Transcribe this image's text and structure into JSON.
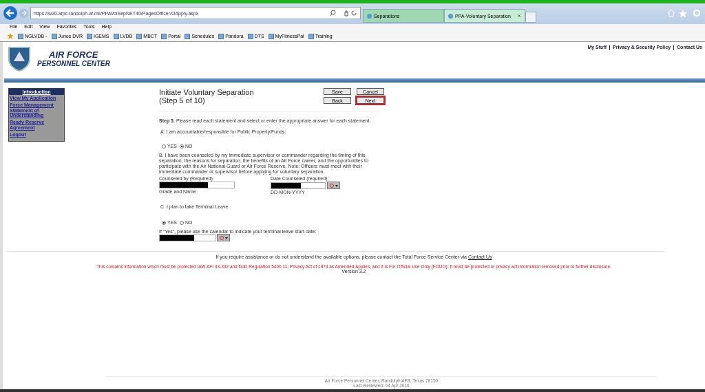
{
  "browser": {
    "url": "https://w20.afpc.randolph.af.mil/PPAVolSepNET40/PagesOfficer/OApply.aspx",
    "tabs": [
      {
        "label": "Separations",
        "selected": false
      },
      {
        "label": "PPA-Voluntary Separation",
        "selected": true
      }
    ],
    "menu": [
      "File",
      "Edit",
      "View",
      "Favorites",
      "Tools",
      "Help"
    ],
    "favorites": [
      "NGLVDB -",
      "Junos DVR",
      "IGEMS",
      "LVDB",
      "MBCT",
      "Portal",
      "Schedules",
      "Pandora",
      "DTS",
      "MyFitnessPal",
      "Training"
    ]
  },
  "top_links": [
    "My Stuff",
    "Privacy & Security Policy",
    "Contact Us"
  ],
  "logo": {
    "line1": "AIR FORCE",
    "line2": "PERSONNEL CENTER"
  },
  "sidebar": {
    "title": "Introduction",
    "items": [
      "View My Application",
      "Force Management Statement of Understanding",
      "Ready Reserve Agreement",
      "Logout"
    ]
  },
  "page": {
    "title": "Initiate Voluntary Separation",
    "subtitle": "(Step 5 of 10)",
    "buttons": [
      {
        "label": "Save",
        "highlighted": false
      },
      {
        "label": "Cancel",
        "highlighted": false
      },
      {
        "label": "Back",
        "highlighted": false
      },
      {
        "label": "Next",
        "highlighted": true
      }
    ],
    "instructions": "**Step 5.** Please read each statement and select or enter the appropriate answer for each statement.",
    "question_a": {
      "text": "A. I am accountable/responsible for Public Property/Funds:",
      "options": [
        {
          "label": "YES",
          "selected": false
        },
        {
          "label": "NO",
          "selected": true
        }
      ]
    },
    "question_b": {
      "text": "B. I have been counseled by my immediate supervisor or commander regarding the timing of this separation, the reasons for separation, the benefits of an Air Force career, and the opportunities to participate with the Air National Guard or Air Force Reserve. Note: Officers must meet with their immediate commander or supervisor before applying for voluntary separation",
      "counseled_by_label": "Counseled by (Required):",
      "counseled_by_hint": "Grade and Name",
      "date_label": "Date Counseled (required):",
      "date_hint": "DD-MON-YYYY"
    },
    "question_c": {
      "text": "C. I plan to take Terminal Leave:",
      "options": [
        {
          "label": "YES",
          "selected": true
        },
        {
          "label": "NO",
          "selected": false
        }
      ],
      "date_label": "If \"Yes\", please use the calendar to indicate your terminal leave start date:"
    }
  },
  "assistance": {
    "text": "If you require assistance or do not understand the available options, please contact the Total Force Service Center via",
    "link": "Contact Us"
  },
  "notice": "This contains information which must be protected IAW AFI 33-332 and DoD Regulation 5400.11; Privacy Act of 1974 as Amended Applies, and it is For Official Use Only (FOUO). It must be protected or privacy act information removed prior to further disclosure.",
  "version": "Version 3.2",
  "footer": {
    "address": "Air Force Personnel Center, Randolph AFB, Texas 78150",
    "reviewed": "Last Reviewed: 04 Apr 2016"
  }
}
